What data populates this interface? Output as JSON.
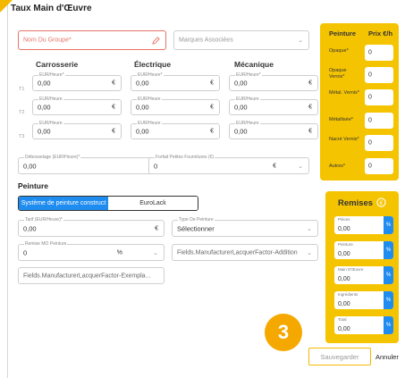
{
  "title": "Taux Main d'Œuvre",
  "group_name": {
    "placeholder": "Nom Du Groupe*"
  },
  "brands": {
    "placeholder": "Marques Associées"
  },
  "columns": [
    "Carrosserie",
    "Électrique",
    "Mécanique"
  ],
  "rate_rows": [
    {
      "label": "T1",
      "cells": [
        {
          "lbl": "EUR/Heure*",
          "val": "0,00",
          "unit": "€"
        },
        {
          "lbl": "EUR/Heure*",
          "val": "0,00",
          "unit": "€"
        },
        {
          "lbl": "EUR/Heure*",
          "val": "0,00",
          "unit": "€"
        }
      ]
    },
    {
      "label": "T2",
      "cells": [
        {
          "lbl": "EUR/Heure",
          "val": "0,00",
          "unit": "€"
        },
        {
          "lbl": "EUR/Heure",
          "val": "0,00",
          "unit": "€"
        },
        {
          "lbl": "EUR/Heure",
          "val": "0,00",
          "unit": "€"
        }
      ]
    },
    {
      "label": "T3",
      "cells": [
        {
          "lbl": "EUR/Heure",
          "val": "0,00",
          "unit": "€"
        },
        {
          "lbl": "EUR/Heure",
          "val": "0,00",
          "unit": "€"
        },
        {
          "lbl": "EUR/Heure",
          "val": "0,00",
          "unit": "€"
        }
      ]
    }
  ],
  "debosselage": {
    "label": "Débosselage (EUR/Heure)*",
    "value": "0,00",
    "unit": "€"
  },
  "forfait": {
    "label": "Forfait Petites Fournitures (€)",
    "value": "0",
    "unit": "€"
  },
  "peinture_title": "Peinture",
  "paint_system": {
    "options": [
      "Système de peinture construct",
      "EuroLack"
    ]
  },
  "tarif": {
    "label": "Tarif (EUR/Heure)*",
    "value": "0,00",
    "unit": "€"
  },
  "type_peinture": {
    "label": "Type De Peinture",
    "value": "Sélectionner"
  },
  "remise_mo": {
    "label": "Remise MO Peinture",
    "value": "0",
    "unit": "%"
  },
  "manufacturer_addition": {
    "value": "Fields.ManufacturerLacquerFactor-Addition"
  },
  "manufacturer_example": {
    "value": "Fields.ManufacturerLacquerFactor-Exempla..."
  },
  "paint_panel": {
    "headers": [
      "Peinture",
      "Prix €/h"
    ],
    "rows": [
      {
        "label": "Opaque*",
        "value": "0"
      },
      {
        "label": "Opaque Vernis*",
        "value": "0"
      },
      {
        "label": "Métal. Vernis*",
        "value": "0"
      },
      {
        "label": "Métallisée*",
        "value": "0"
      },
      {
        "label": "Nacré Vernis*",
        "value": "0"
      },
      {
        "label": "Autres*",
        "value": "0"
      }
    ]
  },
  "remises": {
    "title": "Remises",
    "items": [
      {
        "label": "Pièces",
        "value": "0,00",
        "unit": "%"
      },
      {
        "label": "Peinture",
        "value": "0,00",
        "unit": "%"
      },
      {
        "label": "Main D'Œuvre",
        "value": "0,00",
        "unit": "%"
      },
      {
        "label": "Ingrédients",
        "value": "0,00",
        "unit": "%"
      },
      {
        "label": "Total",
        "value": "0,00",
        "unit": "%"
      }
    ]
  },
  "step_badge": "3",
  "buttons": {
    "save": "Sauvegarder",
    "cancel": "Annuler"
  },
  "colors": {
    "accent": "#f5c400",
    "blue": "#1f8cf0",
    "error": "#e8746a"
  }
}
